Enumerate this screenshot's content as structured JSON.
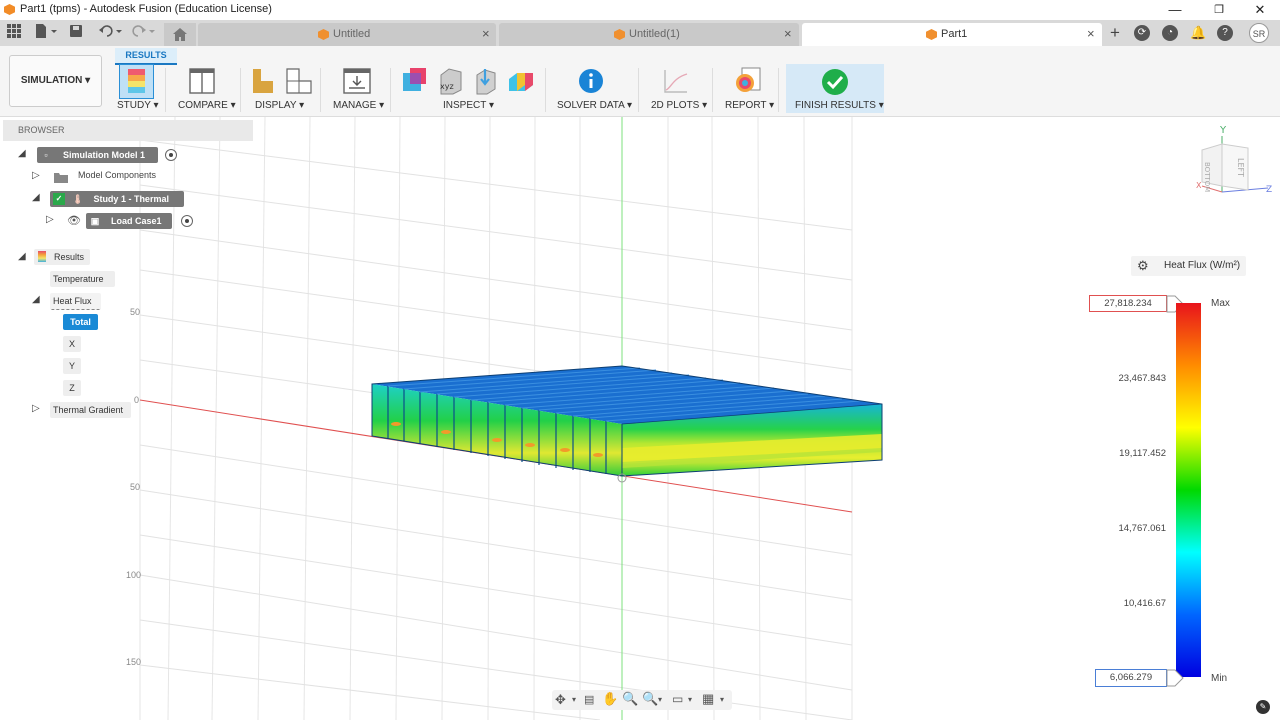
{
  "window": {
    "title": "Part1 (tpms) - Autodesk Fusion (Education License)",
    "min_glyph": "—",
    "max_glyph": "❐",
    "close_glyph": "✕"
  },
  "tabs": [
    {
      "label": "Untitled"
    },
    {
      "label": "Untitled(1)"
    },
    {
      "label": "Part1"
    }
  ],
  "user_initials": "SR",
  "ribbon": {
    "active_tab": "RESULTS",
    "workspace": "SIMULATION",
    "groups": [
      {
        "label": "STUDY"
      },
      {
        "label": "COMPARE"
      },
      {
        "label": "DISPLAY"
      },
      {
        "label": "MANAGE"
      },
      {
        "label": "INSPECT"
      },
      {
        "label": "SOLVER DATA"
      },
      {
        "label": "2D PLOTS"
      },
      {
        "label": "REPORT"
      },
      {
        "label": "FINISH RESULTS"
      }
    ]
  },
  "browser": {
    "header": "BROWSER",
    "simulation_model": "Simulation Model 1",
    "model_components": "Model Components",
    "study": "Study 1 - Thermal",
    "load_case": "Load Case1",
    "results": "Results",
    "temperature": "Temperature",
    "heat_flux": "Heat Flux",
    "total": "Total",
    "x": "X",
    "y": "Y",
    "z": "Z",
    "thermal_gradient": "Thermal Gradient"
  },
  "grid_labels": [
    "50",
    "0",
    "50",
    "100",
    "150"
  ],
  "viewcube": {
    "top": "BOTTOM",
    "right": "LEFT",
    "axis_y": "Y",
    "axis_x": "X",
    "axis_z": "Z"
  },
  "legend": {
    "title": "Heat Flux (W/m²)",
    "max_value": "27,818.234",
    "min_value": "6,066.279",
    "max_label": "Max",
    "min_label": "Min",
    "ticks": [
      "23,467.843",
      "19,117.452",
      "14,767.061",
      "10,416.67"
    ],
    "colors": [
      "#e8141c",
      "#ff8c00",
      "#ffff00",
      "#00d900",
      "#00ffff",
      "#0066ff",
      "#0000e0"
    ]
  }
}
